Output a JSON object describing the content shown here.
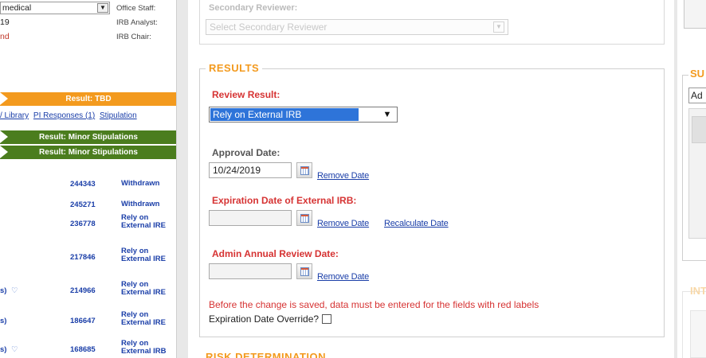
{
  "left_panel": {
    "department_value": "medical",
    "row2_left": "19",
    "row3_left": "nd",
    "office_staff_label": "Office Staff:",
    "irb_analyst_label": "IRB Analyst:",
    "irb_chair_label": "IRB Chair:",
    "result_tbd": "Result: TBD",
    "links": {
      "library": "/ Library",
      "pi_responses": "PI Responses (1)",
      "stipulations": "Stipulation"
    },
    "minor_stip_1": "Result: Minor Stipulations",
    "minor_stip_2": "Result: Minor Stipulations",
    "previous_reviews": [
      {
        "prefix": "",
        "number": "244343",
        "status": "Withdrawn"
      },
      {
        "prefix": "",
        "number": "245271",
        "status": "Withdrawn"
      },
      {
        "prefix": "",
        "number": "236778",
        "status": "Rely on External IRE"
      },
      {
        "prefix": "",
        "number": "217846",
        "status": "Rely on External IRE"
      },
      {
        "prefix": "s)",
        "number": "214966",
        "status": "Rely on External IRE"
      },
      {
        "prefix": "s)",
        "number": "186647",
        "status": "Rely on External IRE"
      },
      {
        "prefix": "s)",
        "number": "168685",
        "status": "Rely on External IRB"
      }
    ]
  },
  "main": {
    "secondary_reviewer_label": "Secondary Reviewer:",
    "secondary_reviewer_placeholder": "Select Secondary Reviewer",
    "results_title": "RESULTS",
    "review_result_label": "Review Result:",
    "review_result_value": "Rely on External IRB",
    "approval_date_label": "Approval Date:",
    "approval_date_value": "10/24/2019",
    "remove_date_label": "Remove Date",
    "expiration_label": "Expiration Date of External IRB:",
    "recalculate_label": "Recalculate Date",
    "admin_annual_label": "Admin Annual Review Date:",
    "warning_text": "Before the change is saved, data must be entered for the fields with red labels",
    "override_label": "Expiration Date Override?",
    "risk_title": "RISK DETERMINATION"
  },
  "right_panel": {
    "su_title": "SU",
    "ad_value": "Ad",
    "int_title": "INT"
  },
  "colors": {
    "accent_orange": "#f39a1e",
    "required_red": "#d63333",
    "link_blue": "#1a3ea8",
    "green_banner": "#4b7d1e",
    "select_highlight": "#2e74d9"
  }
}
